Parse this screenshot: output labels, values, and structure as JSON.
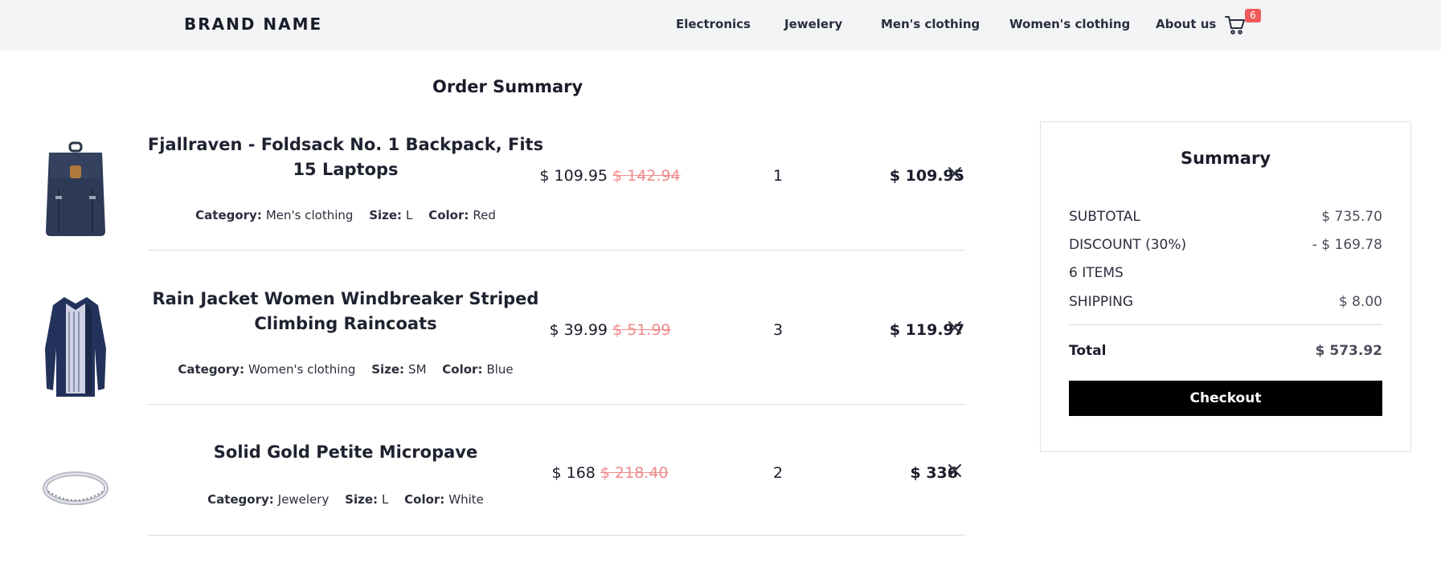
{
  "header": {
    "brand": "BRAND NAME",
    "nav": [
      "Electronics",
      "Jewelery",
      "Men's clothing",
      "Women's clothing",
      "About us"
    ],
    "cart_count": "6",
    "cart_icon": "shopping-cart-icon"
  },
  "page_title": "Order Summary",
  "items": [
    {
      "name": "Fjallraven - Foldsack No. 1 Backpack, Fits 15 Laptops",
      "category_label": "Category:",
      "category": "Men's clothing",
      "size_label": "Size:",
      "size": "L",
      "color_label": "Color:",
      "color": "Red",
      "price": "$ 109.95",
      "old_price": "$ 142.94",
      "quantity": "1",
      "total": "$ 109.95",
      "image_icon": "backpack-icon"
    },
    {
      "name": "Rain Jacket Women Windbreaker Striped Climbing Raincoats",
      "category_label": "Category:",
      "category": "Women's clothing",
      "size_label": "Size:",
      "size": "SM",
      "color_label": "Color:",
      "color": "Blue",
      "price": "$ 39.99",
      "old_price": "$ 51.99",
      "quantity": "3",
      "total": "$ 119.97",
      "image_icon": "jacket-icon"
    },
    {
      "name": "Solid Gold Petite Micropave",
      "category_label": "Category:",
      "category": "Jewelery",
      "size_label": "Size:",
      "size": "L",
      "color_label": "Color:",
      "color": "White",
      "price": "$ 168",
      "old_price": "$ 218.40",
      "quantity": "2",
      "total": "$ 336",
      "image_icon": "ring-icon"
    }
  ],
  "summary": {
    "title": "Summary",
    "subtotal_label": "SUBTOTAL",
    "subtotal": "$ 735.70",
    "discount_label": "DISCOUNT (30%)",
    "discount": "- $ 169.78",
    "items_label": "6 ITEMS",
    "shipping_label": "SHIPPING",
    "shipping": "$ 8.00",
    "total_label": "Total",
    "total": "$ 573.92",
    "checkout_label": "Checkout"
  },
  "colors": {
    "header_bg": "#f3f4f6",
    "badge": "#ef5a5a",
    "old_price": "#f08a8a",
    "checkout_bg": "#000000"
  }
}
